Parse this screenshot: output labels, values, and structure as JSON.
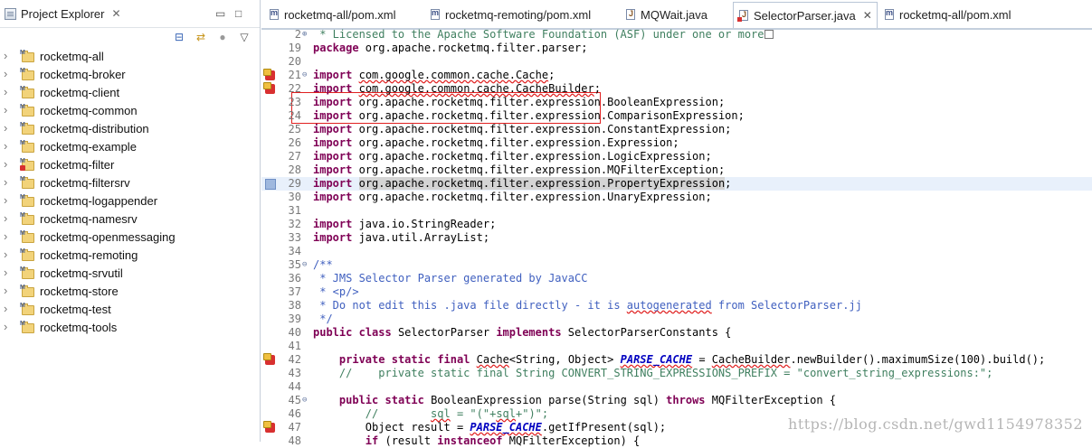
{
  "explorer": {
    "title": "Project Explorer",
    "close": "✕",
    "minimize": "▭",
    "maximize": "□",
    "toolbar": {
      "collapse_all": "⊟",
      "link_editor": "⇄",
      "focus": "●",
      "menu": "▽"
    },
    "projects": [
      {
        "name": "rocketmq-all",
        "error": false
      },
      {
        "name": "rocketmq-broker",
        "error": false
      },
      {
        "name": "rocketmq-client",
        "error": false
      },
      {
        "name": "rocketmq-common",
        "error": false
      },
      {
        "name": "rocketmq-distribution",
        "error": false
      },
      {
        "name": "rocketmq-example",
        "error": false
      },
      {
        "name": "rocketmq-filter",
        "error": true
      },
      {
        "name": "rocketmq-filtersrv",
        "error": false
      },
      {
        "name": "rocketmq-logappender",
        "error": false
      },
      {
        "name": "rocketmq-namesrv",
        "error": false
      },
      {
        "name": "rocketmq-openmessaging",
        "error": false
      },
      {
        "name": "rocketmq-remoting",
        "error": false
      },
      {
        "name": "rocketmq-srvutil",
        "error": false
      },
      {
        "name": "rocketmq-store",
        "error": false
      },
      {
        "name": "rocketmq-test",
        "error": false
      },
      {
        "name": "rocketmq-tools",
        "error": false
      }
    ]
  },
  "tabs": [
    {
      "label": "rocketmq-all/pom.xml",
      "type": "m",
      "error": false,
      "active": false
    },
    {
      "label": "rocketmq-remoting/pom.xml",
      "type": "m",
      "error": false,
      "active": false
    },
    {
      "label": "MQWait.java",
      "type": "j",
      "error": false,
      "active": false
    },
    {
      "label": "SelectorParser.java",
      "type": "j",
      "error": true,
      "active": true,
      "close": "✕"
    },
    {
      "label": "rocketmq-all/pom.xml",
      "type": "m",
      "error": false,
      "active": false
    }
  ],
  "code": {
    "lines": [
      {
        "n": "2",
        "fold": "⊕",
        "text": " * Licensed to the Apache Software Foundation (ASF) under one or more"
      },
      {
        "n": "19",
        "text": "package org.apache.rocketmq.filter.parser;"
      },
      {
        "n": "20",
        "text": ""
      },
      {
        "n": "21",
        "fold": "⊖",
        "marker": "err",
        "text": "import com.google.common.cache.Cache;"
      },
      {
        "n": "22",
        "marker": "err",
        "text": "import com.google.common.cache.CacheBuilder;"
      },
      {
        "n": "23",
        "text": "import org.apache.rocketmq.filter.expression.BooleanExpression;"
      },
      {
        "n": "24",
        "text": "import org.apache.rocketmq.filter.expression.ComparisonExpression;"
      },
      {
        "n": "25",
        "text": "import org.apache.rocketmq.filter.expression.ConstantExpression;"
      },
      {
        "n": "26",
        "text": "import org.apache.rocketmq.filter.expression.Expression;"
      },
      {
        "n": "27",
        "text": "import org.apache.rocketmq.filter.expression.LogicExpression;"
      },
      {
        "n": "28",
        "text": "import org.apache.rocketmq.filter.expression.MQFilterException;"
      },
      {
        "n": "29",
        "marker": "occ",
        "text": "import org.apache.rocketmq.filter.expression.PropertyExpression;"
      },
      {
        "n": "30",
        "text": "import org.apache.rocketmq.filter.expression.UnaryExpression;"
      },
      {
        "n": "31",
        "text": ""
      },
      {
        "n": "32",
        "text": "import java.io.StringReader;"
      },
      {
        "n": "33",
        "text": "import java.util.ArrayList;"
      },
      {
        "n": "34",
        "text": ""
      },
      {
        "n": "35",
        "fold": "⊖",
        "text": "/**"
      },
      {
        "n": "36",
        "text": " * JMS Selector Parser generated by JavaCC"
      },
      {
        "n": "37",
        "text": " * <p/>"
      },
      {
        "n": "38",
        "text": " * Do not edit this .java file directly - it is autogenerated from SelectorParser.jj"
      },
      {
        "n": "39",
        "text": " */"
      },
      {
        "n": "40",
        "text": "public class SelectorParser implements SelectorParserConstants {"
      },
      {
        "n": "41",
        "text": ""
      },
      {
        "n": "42",
        "marker": "err",
        "text": "    private static final Cache<String, Object> PARSE_CACHE = CacheBuilder.newBuilder().maximumSize(100).build();"
      },
      {
        "n": "43",
        "text": "    //    private static final String CONVERT_STRING_EXPRESSIONS_PREFIX = \"convert_string_expressions:\";"
      },
      {
        "n": "44",
        "text": ""
      },
      {
        "n": "45",
        "fold": "⊖",
        "text": "    public static BooleanExpression parse(String sql) throws MQFilterException {"
      },
      {
        "n": "46",
        "text": "        //        sql = \"(\"+sql+\")\";"
      },
      {
        "n": "47",
        "marker": "err",
        "text": "        Object result = PARSE_CACHE.getIfPresent(sql);"
      },
      {
        "n": "48",
        "text": "        if (result instanceof MQFilterException) {"
      }
    ]
  },
  "watermark": "https://blog.csdn.net/gwd1154978352",
  "colors": {
    "keyword": "#7f0055",
    "comment": "#3f7f5f",
    "javadoc": "#3f5fbf",
    "string": "#2a00ff",
    "field": "#0000c0",
    "error": "#e02020"
  }
}
